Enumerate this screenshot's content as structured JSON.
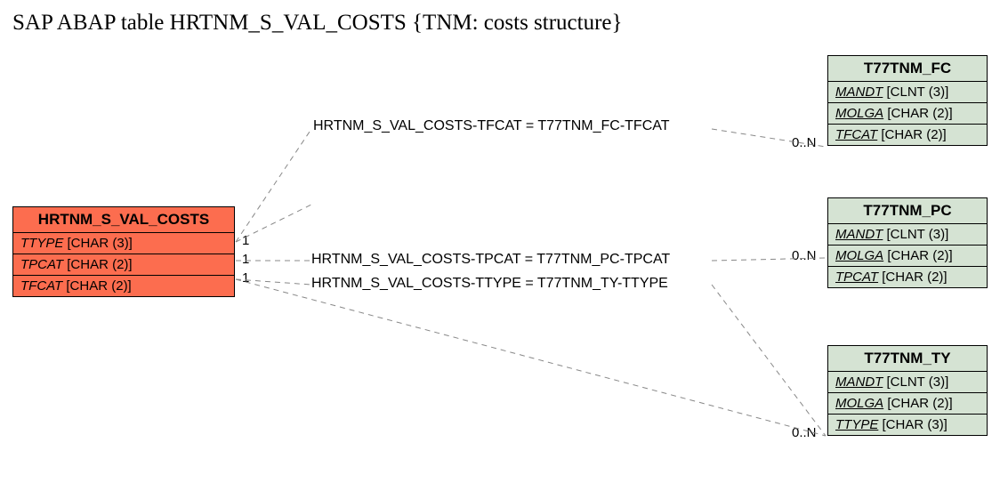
{
  "title": "SAP ABAP table HRTNM_S_VAL_COSTS {TNM: costs structure}",
  "main_entity": {
    "name": "HRTNM_S_VAL_COSTS",
    "fields": [
      {
        "name": "TTYPE",
        "type": "[CHAR (3)]"
      },
      {
        "name": "TPCAT",
        "type": "[CHAR (2)]"
      },
      {
        "name": "TFCAT",
        "type": "[CHAR (2)]"
      }
    ]
  },
  "related": [
    {
      "name": "T77TNM_FC",
      "fields": [
        {
          "name": "MANDT",
          "type": "[CLNT (3)]",
          "key": true
        },
        {
          "name": "MOLGA",
          "type": "[CHAR (2)]",
          "key": true
        },
        {
          "name": "TFCAT",
          "type": "[CHAR (2)]",
          "key": true
        }
      ]
    },
    {
      "name": "T77TNM_PC",
      "fields": [
        {
          "name": "MANDT",
          "type": "[CLNT (3)]",
          "key": true
        },
        {
          "name": "MOLGA",
          "type": "[CHAR (2)]",
          "key": true
        },
        {
          "name": "TPCAT",
          "type": "[CHAR (2)]",
          "key": true
        }
      ]
    },
    {
      "name": "T77TNM_TY",
      "fields": [
        {
          "name": "MANDT",
          "type": "[CLNT (3)]",
          "key": true
        },
        {
          "name": "MOLGA",
          "type": "[CHAR (2)]",
          "key": true
        },
        {
          "name": "TTYPE",
          "type": "[CHAR (3)]",
          "key": true
        }
      ]
    }
  ],
  "relations": [
    {
      "label": "HRTNM_S_VAL_COSTS-TFCAT = T77TNM_FC-TFCAT",
      "left_card": "1",
      "right_card": "0..N"
    },
    {
      "label": "HRTNM_S_VAL_COSTS-TPCAT = T77TNM_PC-TPCAT",
      "left_card": "1",
      "right_card": "0..N"
    },
    {
      "label": "HRTNM_S_VAL_COSTS-TTYPE = T77TNM_TY-TTYPE",
      "left_card": "1",
      "right_card": "0..N"
    }
  ],
  "chart_data": {
    "type": "table",
    "entities": [
      {
        "name": "HRTNM_S_VAL_COSTS",
        "fields": [
          "TTYPE CHAR(3)",
          "TPCAT CHAR(2)",
          "TFCAT CHAR(2)"
        ]
      },
      {
        "name": "T77TNM_FC",
        "fields": [
          "MANDT CLNT(3)",
          "MOLGA CHAR(2)",
          "TFCAT CHAR(2)"
        ]
      },
      {
        "name": "T77TNM_PC",
        "fields": [
          "MANDT CLNT(3)",
          "MOLGA CHAR(2)",
          "TPCAT CHAR(2)"
        ]
      },
      {
        "name": "T77TNM_TY",
        "fields": [
          "MANDT CLNT(3)",
          "MOLGA CHAR(2)",
          "TTYPE CHAR(3)"
        ]
      }
    ],
    "relations": [
      {
        "from": "HRTNM_S_VAL_COSTS.TFCAT",
        "to": "T77TNM_FC.TFCAT",
        "card_from": "1",
        "card_to": "0..N"
      },
      {
        "from": "HRTNM_S_VAL_COSTS.TPCAT",
        "to": "T77TNM_PC.TPCAT",
        "card_from": "1",
        "card_to": "0..N"
      },
      {
        "from": "HRTNM_S_VAL_COSTS.TTYPE",
        "to": "T77TNM_TY.TTYPE",
        "card_from": "1",
        "card_to": "0..N"
      }
    ]
  }
}
